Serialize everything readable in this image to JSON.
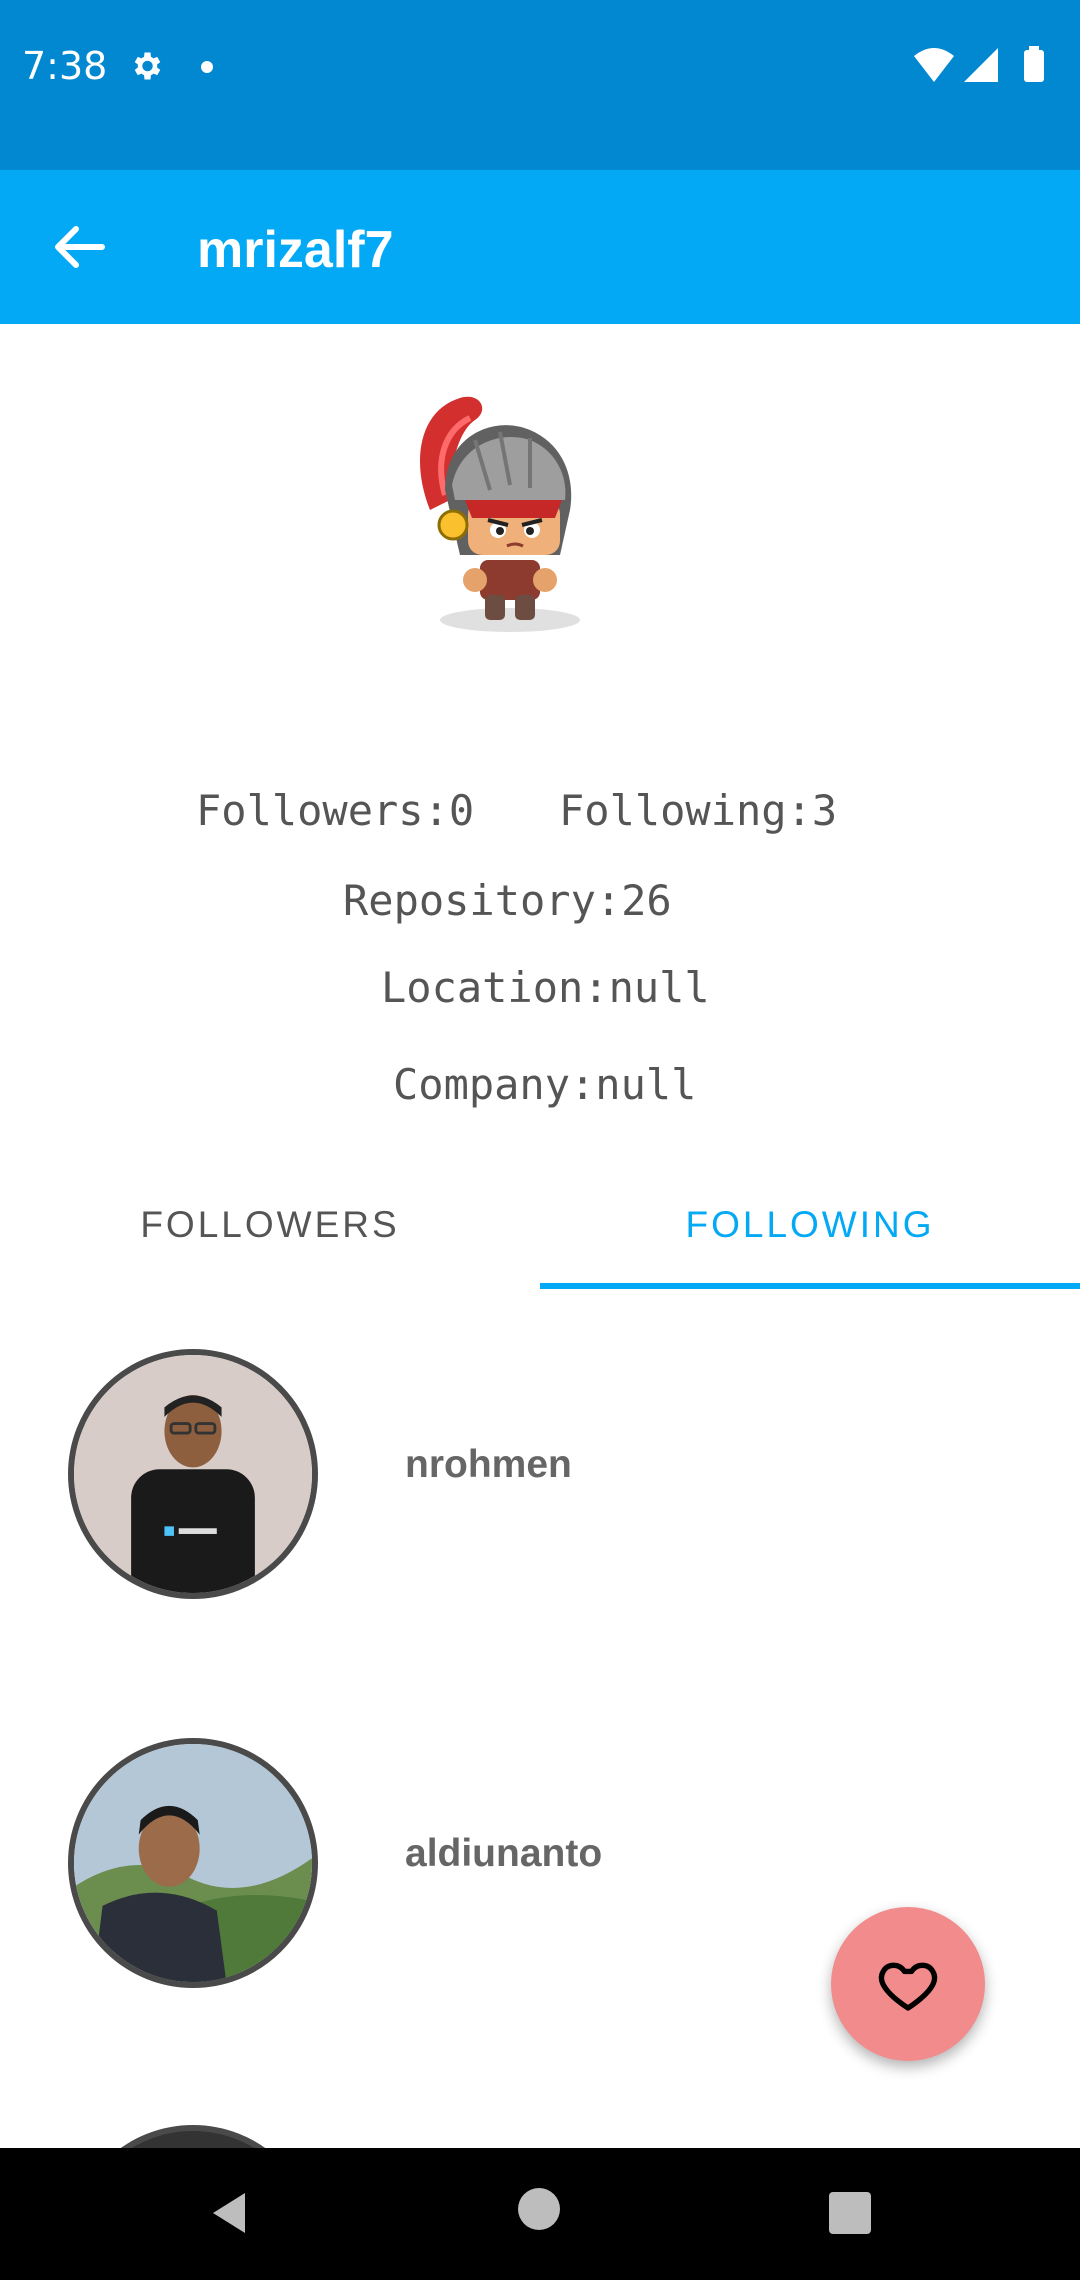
{
  "status_bar": {
    "time": "7:38"
  },
  "app_bar": {
    "title": "mrizalf7"
  },
  "profile": {
    "followers": "Followers:0",
    "following": "Following:3",
    "repository": "Repository:26",
    "location": "Location:null",
    "company": "Company:null"
  },
  "tabs": [
    {
      "label": "FOLLOWERS",
      "selected": false
    },
    {
      "label": "FOLLOWING",
      "selected": true
    }
  ],
  "following_list": [
    {
      "username": "nrohmen"
    },
    {
      "username": "aldiunanto"
    }
  ],
  "colors": {
    "status_bar": "#0288d1",
    "app_bar": "#03a9f4",
    "accent": "#03a9f4",
    "fab": "#f28b8b"
  },
  "icons": {
    "back": "arrow-back-icon",
    "fab": "heart-outline-icon"
  }
}
